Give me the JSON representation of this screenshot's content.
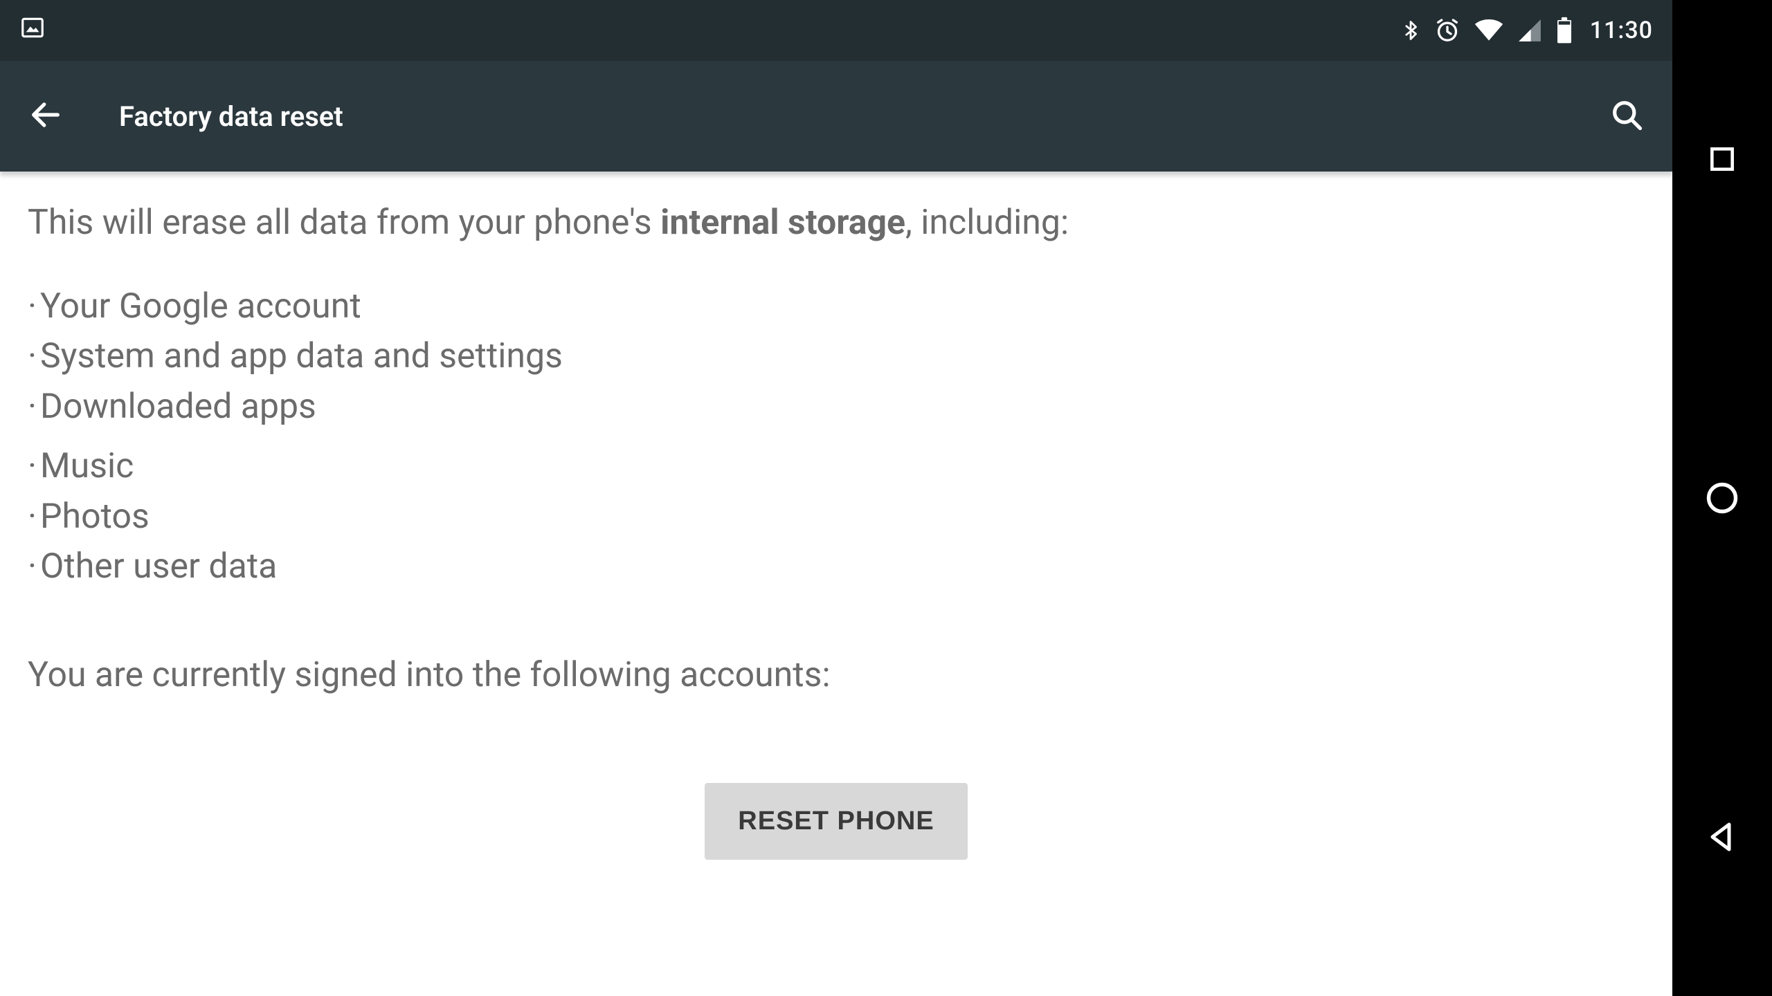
{
  "statusbar": {
    "time": "11:30"
  },
  "appbar": {
    "title": "Factory data reset"
  },
  "content": {
    "intro_prefix": "This will erase all data from your phone's ",
    "intro_strong": "internal storage",
    "intro_suffix": ", including:",
    "list": [
      "Your Google account",
      "System and app data and settings",
      "Downloaded apps",
      "Music",
      "Photos",
      "Other user data"
    ],
    "accounts_line": "You are currently signed into the following accounts:",
    "reset_button": "RESET PHONE"
  }
}
